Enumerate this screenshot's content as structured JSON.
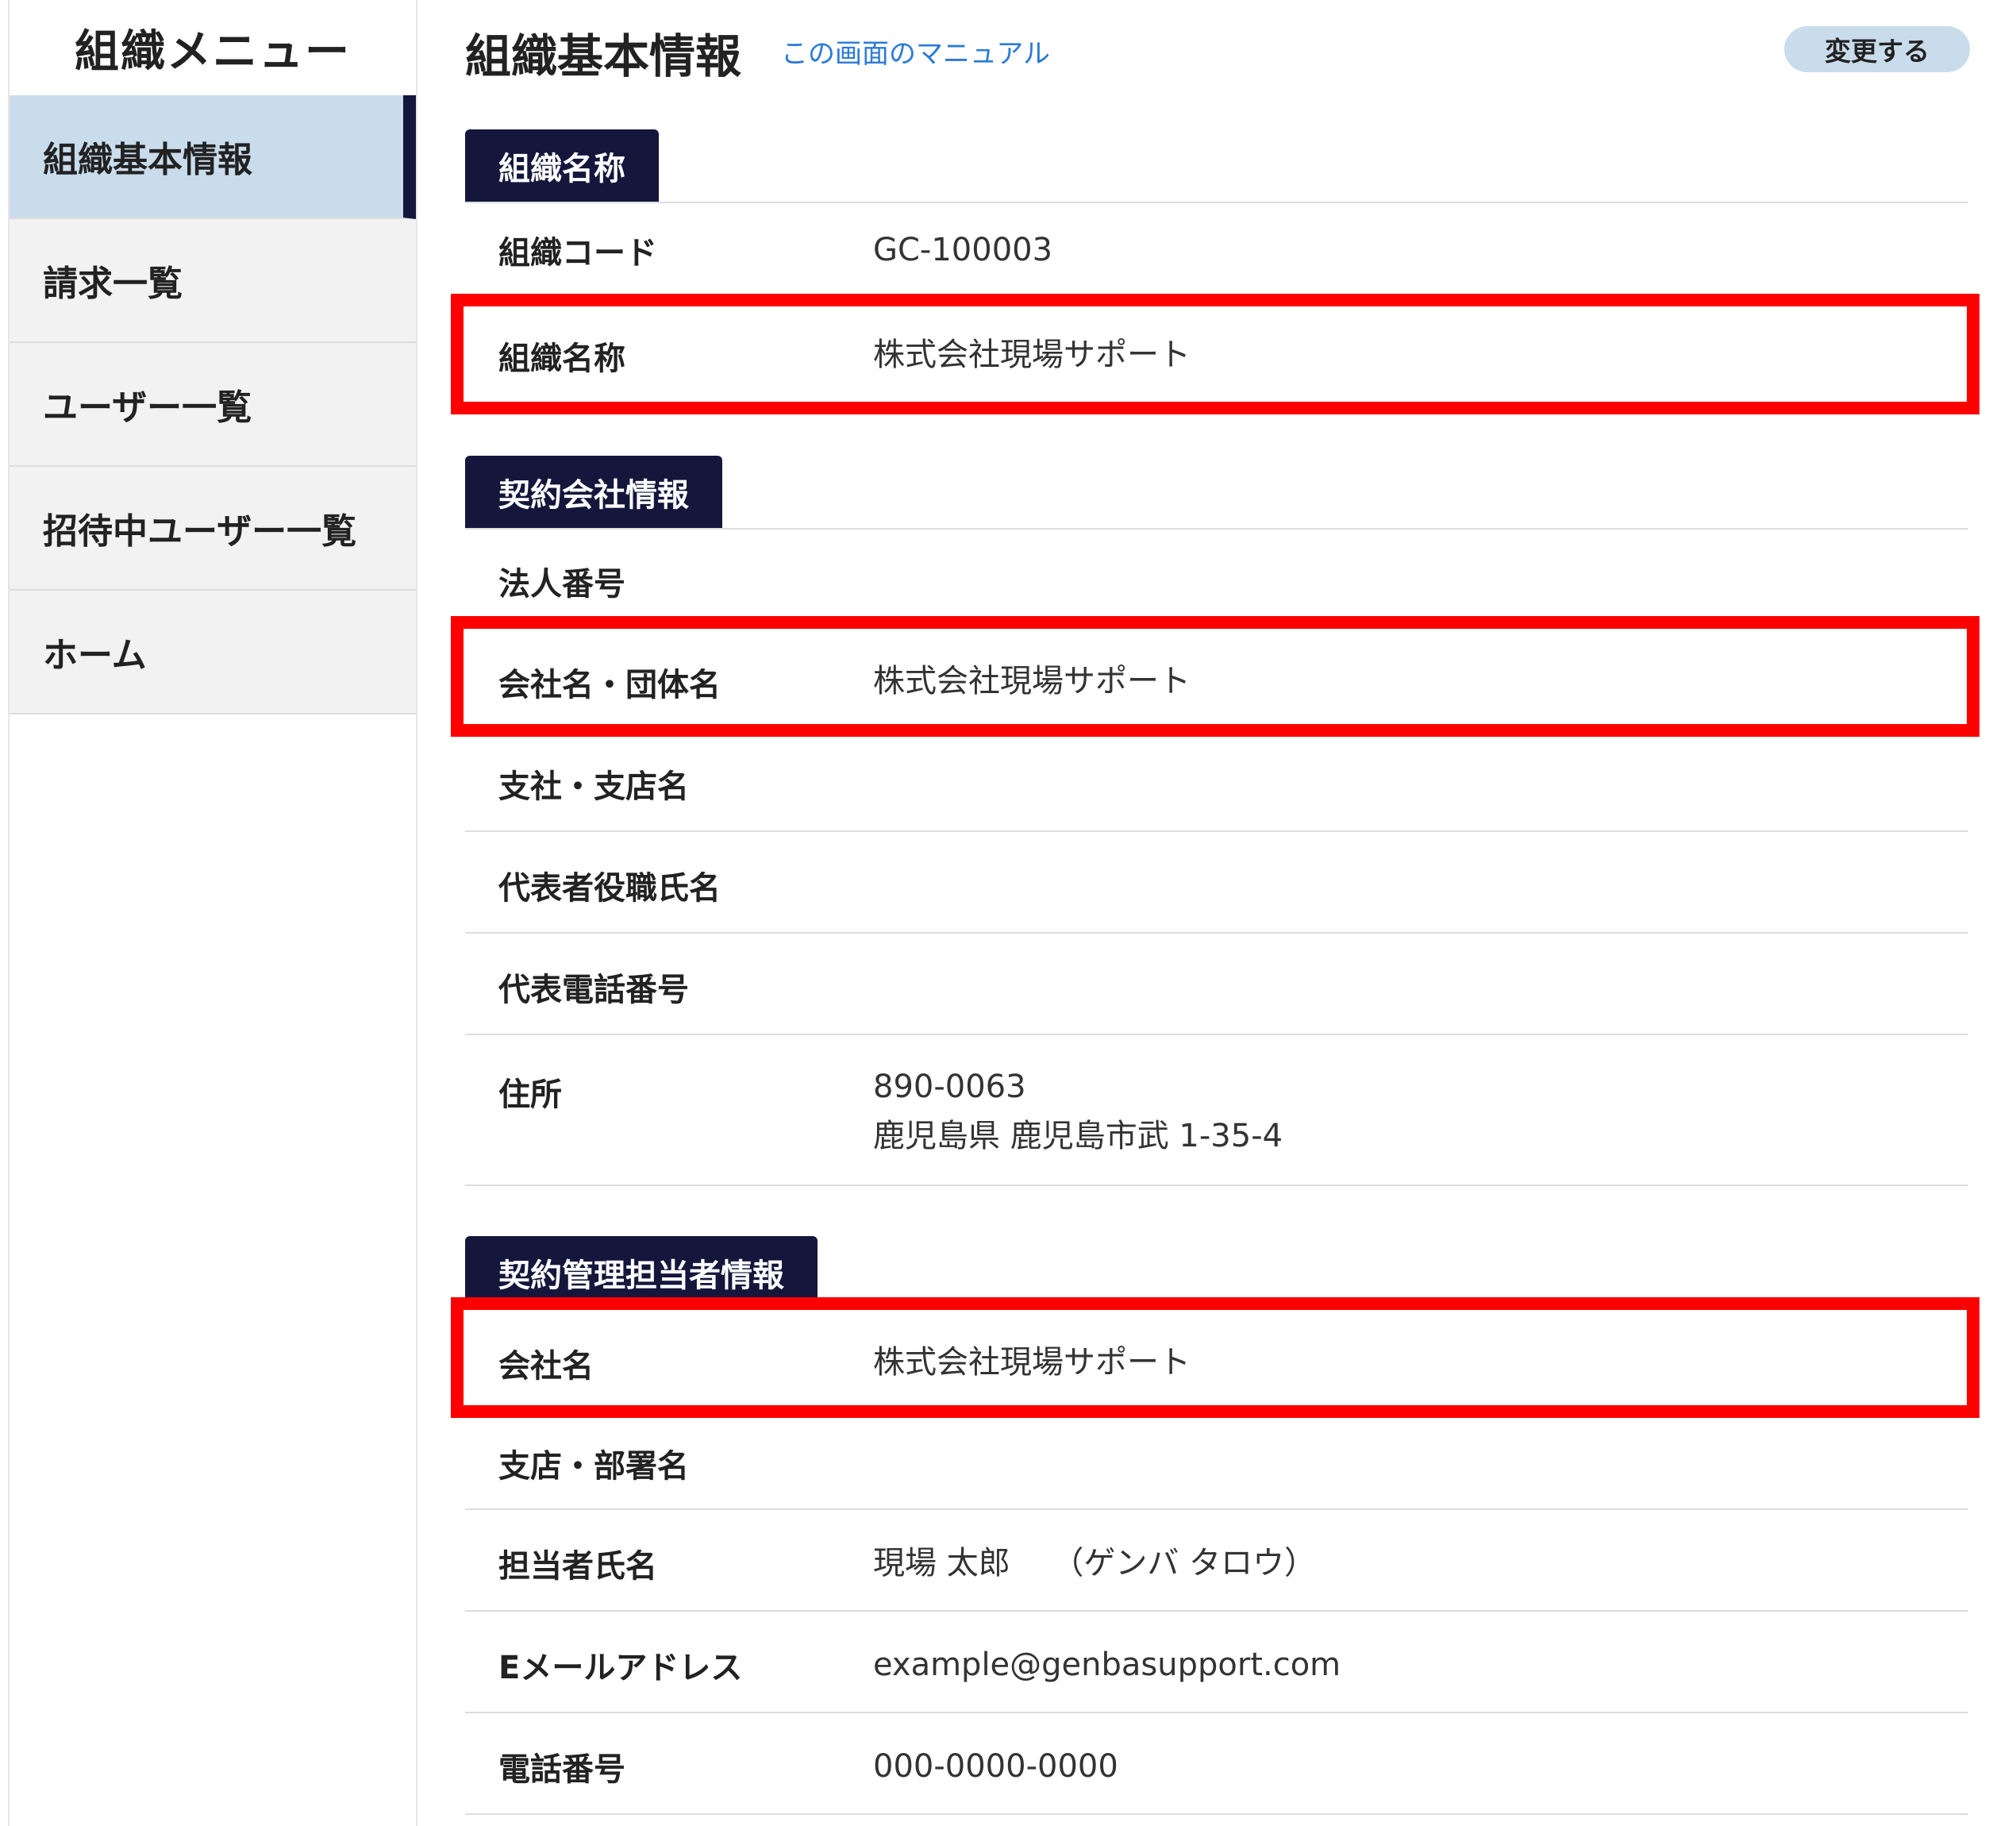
{
  "sidebar": {
    "title": "組織メニュー",
    "items": [
      {
        "label": "組織基本情報",
        "active": true
      },
      {
        "label": "請求一覧"
      },
      {
        "label": "ユーザー一覧"
      },
      {
        "label": "招待中ユーザー一覧"
      },
      {
        "label": "ホーム"
      }
    ]
  },
  "header": {
    "title": "組織基本情報",
    "manual_link": "この画面のマニュアル",
    "edit_button": "変更する"
  },
  "sections": {
    "org": {
      "title": "組織名称",
      "rows": [
        {
          "label": "組織コード",
          "value": "GC-100003"
        },
        {
          "label": "組織名称",
          "value": "株式会社現場サポート"
        }
      ]
    },
    "contract_company": {
      "title": "契約会社情報",
      "rows": [
        {
          "label": "法人番号",
          "value": ""
        },
        {
          "label": "会社名・団体名",
          "value": "株式会社現場サポート"
        },
        {
          "label": "支社・支店名",
          "value": ""
        },
        {
          "label": "代表者役職氏名",
          "value": ""
        },
        {
          "label": "代表電話番号",
          "value": ""
        },
        {
          "label": "住所",
          "postal": "890-0063",
          "address": "鹿児島県 鹿児島市武 1-35-4"
        }
      ]
    },
    "contract_manager": {
      "title": "契約管理担当者情報",
      "rows": [
        {
          "label": "会社名",
          "value": "株式会社現場サポート"
        },
        {
          "label": "支店・部署名",
          "value": ""
        },
        {
          "label": "担当者氏名",
          "value": "現場 太郎　 （ゲンバ タロウ）"
        },
        {
          "label": "Eメールアドレス",
          "value": "example@genbasupport.com"
        },
        {
          "label": "電話番号",
          "value": "000-0000-0000"
        }
      ]
    }
  },
  "colors": {
    "accent": "#14163c",
    "active_bg": "#c9dcec",
    "highlight": "#ff0000",
    "link": "#2b7bd6"
  }
}
